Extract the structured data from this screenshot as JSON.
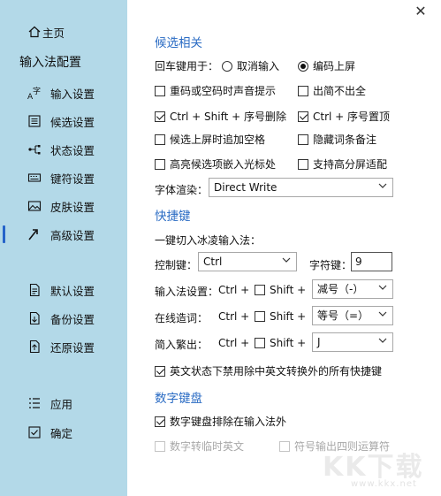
{
  "sidebar": {
    "home": "主页",
    "title": "输入法配置",
    "items": [
      {
        "label": "输入设置",
        "icon": "input-icon"
      },
      {
        "label": "候选设置",
        "icon": "list-icon"
      },
      {
        "label": "状态设置",
        "icon": "flow-icon"
      },
      {
        "label": "键符设置",
        "icon": "keyboard-icon"
      },
      {
        "label": "皮肤设置",
        "icon": "image-icon"
      },
      {
        "label": "高级设置",
        "icon": "advanced-icon"
      },
      {
        "label": "默认设置",
        "icon": "doc-icon"
      },
      {
        "label": "备份设置",
        "icon": "backup-icon"
      },
      {
        "label": "还原设置",
        "icon": "restore-icon"
      },
      {
        "label": "应用",
        "icon": "apply-icon"
      },
      {
        "label": "确定",
        "icon": "confirm-icon"
      }
    ],
    "active_index": 5,
    "accent_color": "#2563c9",
    "bg_color": "#b3d9e8"
  },
  "candidate": {
    "heading": "候选相关",
    "enter_label": "回车键用于：",
    "enter_options": [
      {
        "label": "取消输入",
        "selected": false
      },
      {
        "label": "编码上屏",
        "selected": true
      }
    ],
    "checks": [
      {
        "label": "重码或空码时声音提示",
        "checked": false
      },
      {
        "label": "出简不出全",
        "checked": false
      },
      {
        "label": "Ctrl + Shift + 序号删除",
        "checked": true
      },
      {
        "label": "Ctrl + 序号置顶",
        "checked": true
      },
      {
        "label": "候选上屏时追加空格",
        "checked": false
      },
      {
        "label": "隐藏词条备注",
        "checked": false
      },
      {
        "label": "高亮候选项嵌入光标处",
        "checked": false
      },
      {
        "label": "支持高分屏适配",
        "checked": false
      }
    ],
    "font_render_label": "字体渲染：",
    "font_render_value": "Direct Write"
  },
  "hotkeys": {
    "heading": "快捷键",
    "switch_label": "一键切入冰凌输入法：",
    "control_label": "控制键：",
    "control_value": "Ctrl",
    "char_label": "字符键：",
    "char_value": "9",
    "rows": [
      {
        "label": "输入法设置：",
        "ctrl": "Ctrl +",
        "shift": "Shift +",
        "shift_checked": false,
        "key": "减号（-）"
      },
      {
        "label": "在线造词：",
        "ctrl": "Ctrl +",
        "shift": "Shift +",
        "shift_checked": false,
        "key": "等号（=）"
      },
      {
        "label": "简入繁出：",
        "ctrl": "Ctrl +",
        "shift": "Shift +",
        "shift_checked": false,
        "key": "J"
      }
    ],
    "disable_label": "英文状态下禁用除中英文转换外的所有快捷键",
    "disable_checked": true
  },
  "numpad": {
    "heading": "数字键盘",
    "exclude_label": "数字键盘排除在输入法外",
    "exclude_checked": true,
    "temp_label": "数字转临时英文",
    "ops_label": "符号输出四则运算符"
  },
  "section_color": "#2b6cc4",
  "watermark": {
    "text": "KK下载",
    "url": "www.kkx.net"
  }
}
